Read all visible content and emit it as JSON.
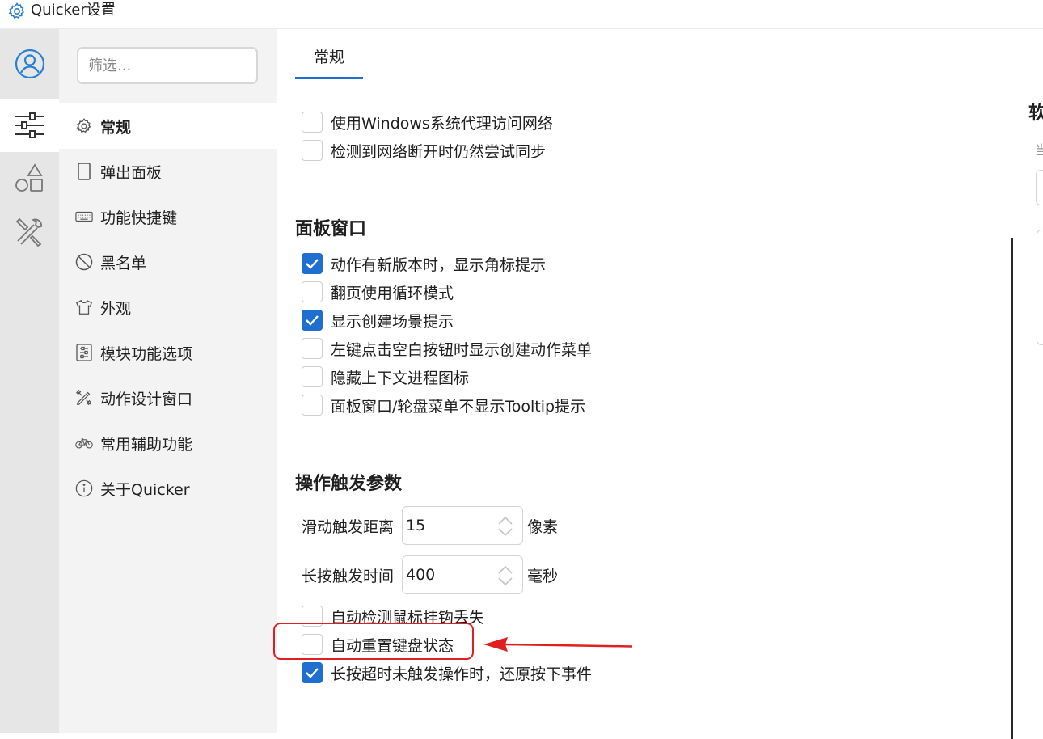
{
  "window": {
    "title": "Quicker设置"
  },
  "iconbar": [
    {
      "name": "user-icon"
    },
    {
      "name": "sliders-icon"
    },
    {
      "name": "shapes-icon"
    },
    {
      "name": "tools-icon"
    }
  ],
  "nav": {
    "filter_placeholder": "筛选...",
    "items": [
      {
        "label": "常规",
        "icon": "gear-icon"
      },
      {
        "label": "弹出面板",
        "icon": "panel-icon"
      },
      {
        "label": "功能快捷键",
        "icon": "keyboard-icon"
      },
      {
        "label": "黑名单",
        "icon": "ban-icon"
      },
      {
        "label": "外观",
        "icon": "shirt-icon"
      },
      {
        "label": "模块功能选项",
        "icon": "module-icon"
      },
      {
        "label": "动作设计窗口",
        "icon": "design-icon"
      },
      {
        "label": "常用辅助功能",
        "icon": "bike-icon"
      },
      {
        "label": "关于Quicker",
        "icon": "info-icon"
      }
    ]
  },
  "main": {
    "tab": "常规",
    "network_options": [
      {
        "label": "使用Windows系统代理访问网络",
        "checked": false
      },
      {
        "label": "检测到网络断开时仍然尝试同步",
        "checked": false
      }
    ],
    "panel_section": {
      "title": "面板窗口",
      "options": [
        {
          "label": "动作有新版本时，显示角标提示",
          "checked": true
        },
        {
          "label": "翻页使用循环模式",
          "checked": false
        },
        {
          "label": "显示创建场景提示",
          "checked": true
        },
        {
          "label": "左键点击空白按钮时显示创建动作菜单",
          "checked": false
        },
        {
          "label": "隐藏上下文进程图标",
          "checked": false
        },
        {
          "label": "面板窗口/轮盘菜单不显示Tooltip提示",
          "checked": false
        }
      ]
    },
    "trigger_section": {
      "title": "操作触发参数",
      "swipe": {
        "label": "滑动触发距离",
        "value": "15",
        "unit": "像素"
      },
      "longpress": {
        "label": "长按触发时间",
        "value": "400",
        "unit": "毫秒"
      },
      "options": [
        {
          "label": "自动检测鼠标挂钩丢失",
          "checked": false
        },
        {
          "label": "自动重置键盘状态",
          "checked": false
        },
        {
          "label": "长按超时未触发操作时，还原按下事件",
          "checked": true
        }
      ]
    },
    "right_panel": {
      "heading_fragment": "软",
      "sub_fragment": "当"
    }
  },
  "annotation": {
    "color": "#e02020"
  }
}
